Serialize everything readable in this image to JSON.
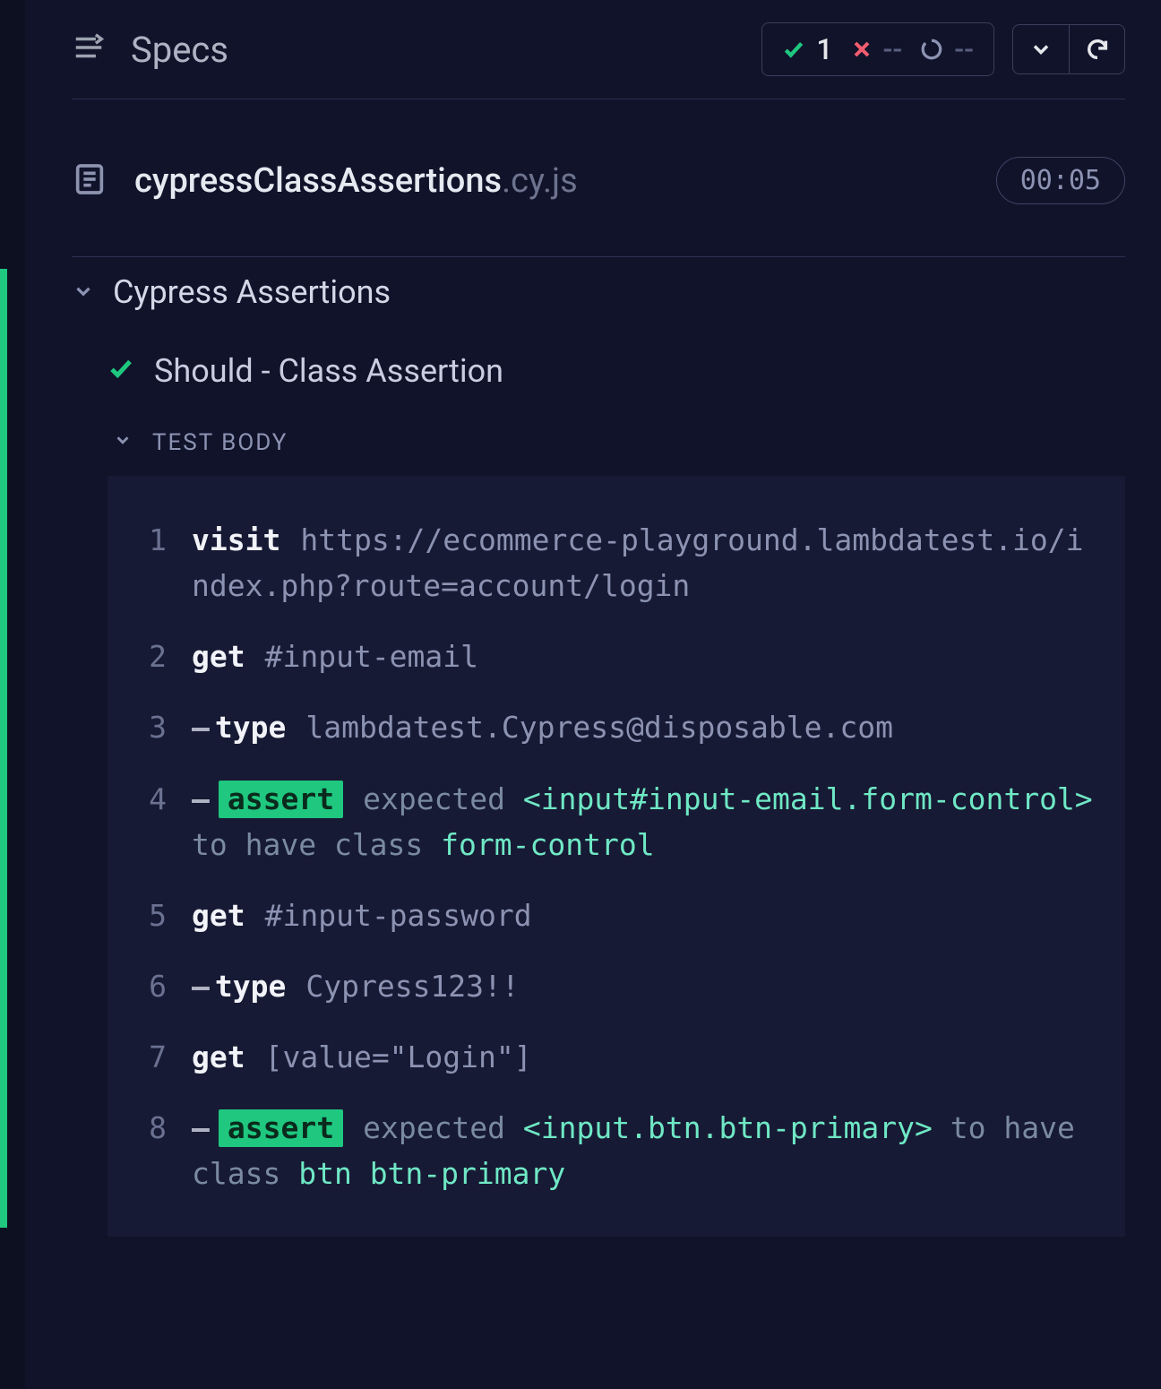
{
  "topbar": {
    "title": "Specs",
    "passed": "1",
    "failed": "--",
    "pending": "--"
  },
  "file": {
    "name": "cypressClassAssertions",
    "ext": ".cy.js",
    "time": "00:05"
  },
  "suite": {
    "title": "Cypress Assertions"
  },
  "test": {
    "title": "Should - Class Assertion",
    "body_label": "TEST BODY"
  },
  "log": {
    "r1": {
      "n": "1",
      "kw": "visit",
      "arg": "https://ecommerce-playground.lambdatest.io/index.php?route=account/login"
    },
    "r2": {
      "n": "2",
      "kw": "get",
      "arg": "#input-email"
    },
    "r3": {
      "n": "3",
      "kw": "type",
      "arg": "lambdatest.Cypress@disposable.com"
    },
    "r4": {
      "n": "4",
      "pill": "assert",
      "t1": "expected ",
      "h1": "<input#input-email.form-control>",
      "t2": " to have class ",
      "h2": "form-control"
    },
    "r5": {
      "n": "5",
      "kw": "get",
      "arg": "#input-password"
    },
    "r6": {
      "n": "6",
      "kw": "type",
      "arg": "Cypress123!!"
    },
    "r7": {
      "n": "7",
      "kw": "get",
      "arg": "[value=\"Login\"]"
    },
    "r8": {
      "n": "8",
      "pill": "assert",
      "t1": "expected ",
      "h1": "<input.btn.btn-primary>",
      "t2": " to have class ",
      "h2": "btn btn-primary"
    }
  }
}
